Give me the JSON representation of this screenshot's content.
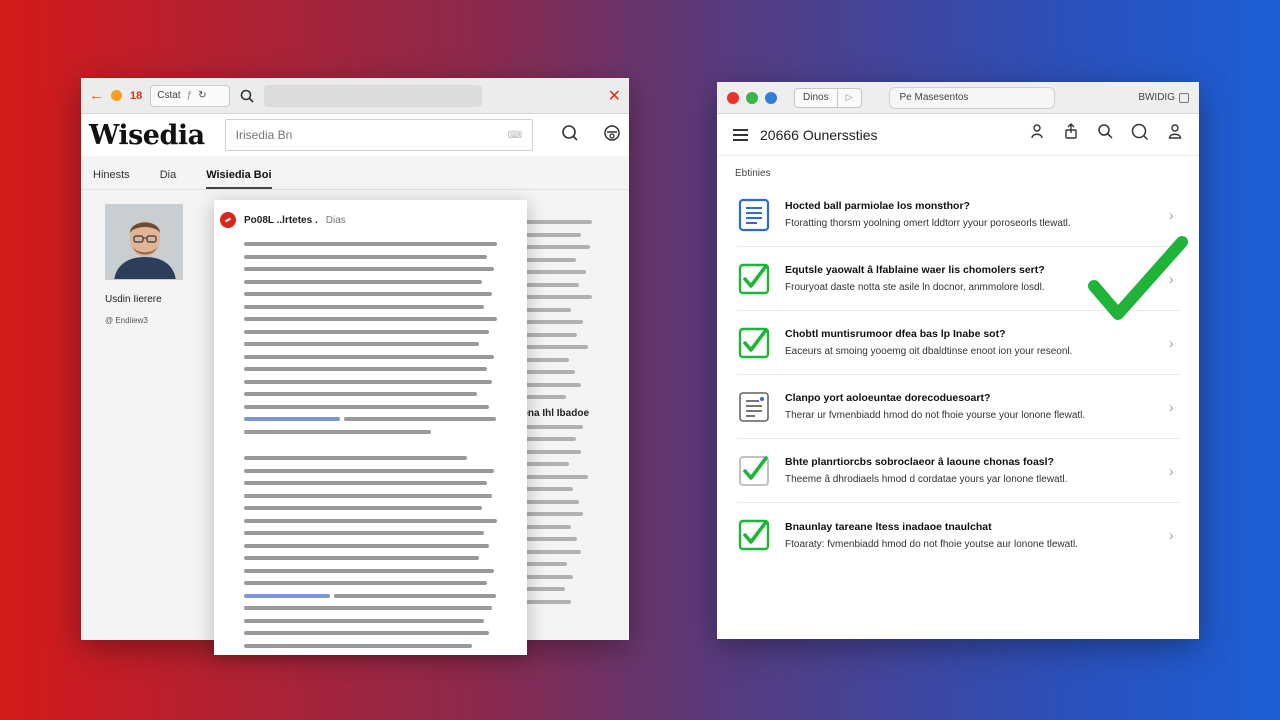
{
  "left_window": {
    "tab_count": "18",
    "tab_label": "Cstat",
    "tab_sep": "ƒ",
    "logo": "Wisedia",
    "search_placeholder": "Irisedia Bn",
    "nav_tabs": [
      "Hinests",
      "Dia",
      "Wisiedia Boi"
    ],
    "profile_name": "Usdin Iierere",
    "profile_meta": "@ Endiiew3",
    "popup_title": "Po08L ..lrtetes .",
    "popup_sub": "Dias",
    "right_heading": "Ibna Ihl Ibadoe"
  },
  "right_window": {
    "toolbar_tab": "Dinos",
    "address": "Pe Masesentos",
    "toolbar_right": "BWIDIG",
    "title": "20666 Ounerssties",
    "section_label": "Ebtinies",
    "questions": [
      {
        "icon": "document-icon",
        "title": "Hocted ball parmiolae los monsthor?",
        "desc": "Ftoratting thorsm yoolning omert lddtorr yyour poroseorls tlewatl."
      },
      {
        "icon": "checkbox-checked-icon",
        "title": "Equtsle yaowalt â lfablaine waer lis chomolers sert?",
        "desc": "Frouryoat daste notta ste asile ln docnor, anmmolore losdl."
      },
      {
        "icon": "checkbox-checked-icon",
        "title": "Chobtl muntisrumoor dfea bas lp Inabe sot?",
        "desc": "Eaceurs at smoing yooemg oit dbaldtinse enoot ion your reseonl."
      },
      {
        "icon": "document-lines-icon",
        "title": "Clanpo yort aoloeuntae dorecoduesoart?",
        "desc": "Therar ur fvmenbiadd hmod do not fhoie yourse your lonone flewatl."
      },
      {
        "icon": "checkbox-checked-icon",
        "title": "Bhte planrtiorcbs sobroclaeor â laoune chonas foasl?",
        "desc": "Theeme â dhrodiaels hmod d cordatae yours yar lonone tlewatl."
      },
      {
        "icon": "checkbox-checked-icon",
        "title": "Bnaunlay tareane ltess inadaoe tnaulchat",
        "desc": "Ftoaraty: fvmenbiadd hmod do not fhoie youtse aur lonone tlewatl."
      }
    ]
  },
  "colors": {
    "check_green": "#1fb33a",
    "doc_blue": "#2f6bd2",
    "traffic_red": "#e8322a",
    "traffic_yellow": "#f0b62c",
    "traffic_green": "#3cb54a",
    "traffic_blue": "#2e7fd8"
  }
}
